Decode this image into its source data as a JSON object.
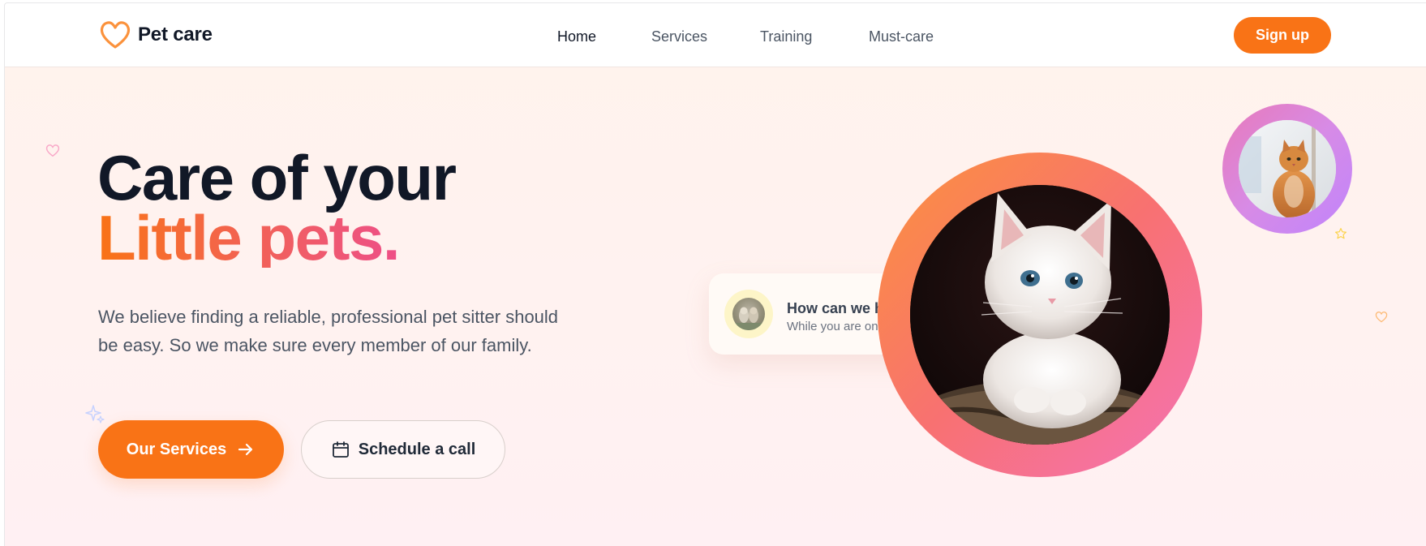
{
  "brand": {
    "name": "Pet care",
    "logo_icon": "heart-outline-icon",
    "accent_color": "#f97316",
    "pink_color": "#ec4899"
  },
  "nav": {
    "items": [
      {
        "label": "Home",
        "active": true
      },
      {
        "label": "Services",
        "active": false
      },
      {
        "label": "Training",
        "active": false
      },
      {
        "label": "Must-care",
        "active": false
      }
    ],
    "signup_label": "Sign up"
  },
  "hero": {
    "title_line1": "Care of your",
    "title_line2": "Little pets.",
    "description": "We believe finding a reliable, professional pet sitter should be easy. So we make sure every member of our family.",
    "primary_button": {
      "label": "Our Services",
      "icon": "arrow-right-icon"
    },
    "secondary_button": {
      "label": "Schedule a call",
      "icon": "calendar-icon"
    }
  },
  "help_card": {
    "title": "How can we h",
    "subtitle": "While you are on",
    "avatar": "dogs-avatar"
  },
  "images": {
    "main": "white-kitten-photo",
    "small": "orange-cat-photo"
  },
  "decorations": [
    "heart-outline-icon",
    "sparkle-icon",
    "star-outline-icon",
    "heart-outline-icon"
  ]
}
